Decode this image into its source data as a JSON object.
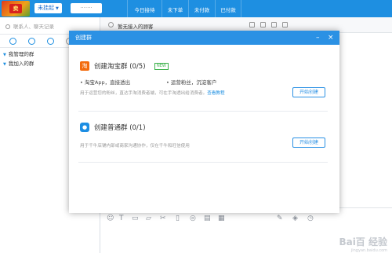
{
  "topbar": {
    "avatar_text": "卖",
    "status": "未挂起",
    "search_placeholder": "",
    "stats": [
      {
        "label": "今日接待"
      },
      {
        "label": "未下单"
      },
      {
        "label": "未付款"
      },
      {
        "label": "已付款"
      }
    ]
  },
  "left": {
    "search_placeholder": "联系人、聊天记录",
    "tree": [
      {
        "label": "我管理的群"
      },
      {
        "label": "我加入的群"
      }
    ]
  },
  "chat": {
    "title": "暂无接入的顾客"
  },
  "modal": {
    "title": "创建群",
    "minimize": "–",
    "close": "×",
    "taobao": {
      "icon": "淘",
      "title": "创建淘宝群 (0/5)",
      "badge": "NEW",
      "bullet1": "• 淘宝App，直接透出",
      "bullet2": "• 运营粉丝，沉淀客户",
      "desc": "用于运营您的粉丝，直达手淘消费者端，可在手淘透出给消费者。",
      "link": "查看教程",
      "button": "开始创建"
    },
    "normal": {
      "icon": "●",
      "title": "创建普通群 (0/1)",
      "desc": "用于千牛店铺内部或商家沟通协作，仅在千牛和旺信使用",
      "button": "开始创建"
    }
  },
  "watermark": {
    "main": "Bai百 经验",
    "sub": "jingyan.baidu.com"
  }
}
